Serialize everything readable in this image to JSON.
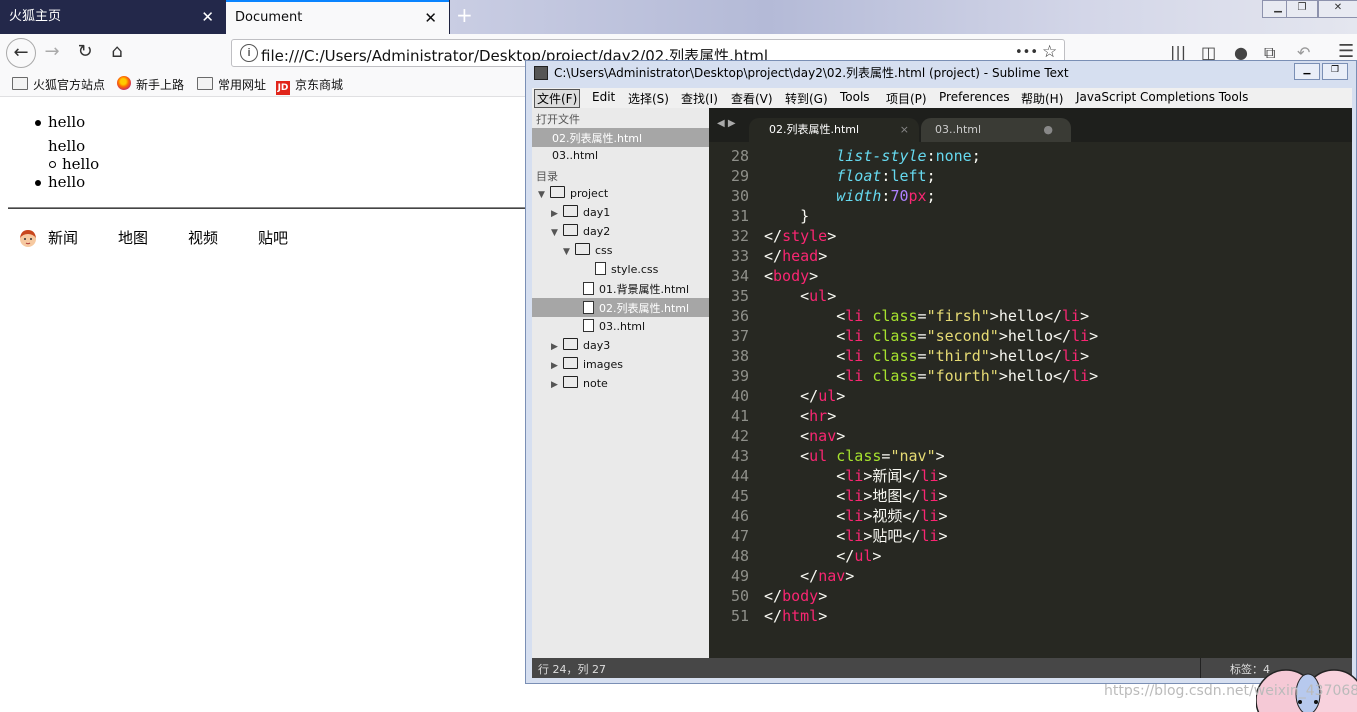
{
  "firefox": {
    "tabs": [
      {
        "label": "火狐主页",
        "close": "✕"
      },
      {
        "label": "Document",
        "close": "✕"
      }
    ],
    "new_tab": "+",
    "url": "file:///C:/Users/Administrator/Desktop/project/day2/02.列表属性.html",
    "url_more": "•••",
    "bookmarks": [
      "火狐官方站点",
      "新手上路",
      "常用网址",
      "京东商城"
    ],
    "jd_badge": "JD"
  },
  "page": {
    "list": [
      "hello",
      "hello",
      "hello",
      "hello"
    ],
    "nav": [
      "新闻",
      "地图",
      "视频",
      "贴吧"
    ]
  },
  "sublime": {
    "title": "C:\\Users\\Administrator\\Desktop\\project\\day2\\02.列表属性.html (project) - Sublime Text",
    "menu": [
      "文件(F)",
      "Edit",
      "选择(S)",
      "查找(I)",
      "查看(V)",
      "转到(G)",
      "Tools",
      "项目(P)",
      "Preferences",
      "帮助(H)",
      "JavaScript Completions Tools"
    ],
    "sidebar": {
      "open_files_header": "打开文件",
      "open_files": [
        "02.列表属性.html",
        "03..html"
      ],
      "folders_header": "目录",
      "tree": [
        "project",
        "day1",
        "day2",
        "css",
        "style.css",
        "01.背景属性.html",
        "02.列表属性.html",
        "03..html",
        "day3",
        "images",
        "note"
      ]
    },
    "tabs": [
      "02.列表属性.html",
      "03..html"
    ],
    "tab_close": "×",
    "tab_dirty": "●",
    "line_numbers": [
      "28",
      "29",
      "30",
      "31",
      "32",
      "33",
      "34",
      "35",
      "36",
      "37",
      "38",
      "39",
      "40",
      "41",
      "42",
      "43",
      "44",
      "45",
      "46",
      "47",
      "48",
      "49",
      "50",
      "51"
    ],
    "code": {
      "l28_prop": "list-style",
      "l28_val": "none",
      "l29_prop": "float",
      "l29_val": "left",
      "l30_prop": "width",
      "l30_num": "70",
      "l30_unit": "px",
      "li_classes": [
        "firsh",
        "second",
        "third",
        "fourth"
      ],
      "li_text": "hello",
      "nav_class": "nav",
      "nav_items": [
        "新闻",
        "地图",
        "视频",
        "贴吧"
      ]
    },
    "status_left": "行 24，列 27",
    "status_right": "标签：4"
  },
  "watermark": "https://blog.csdn.net/weixin_43706846"
}
